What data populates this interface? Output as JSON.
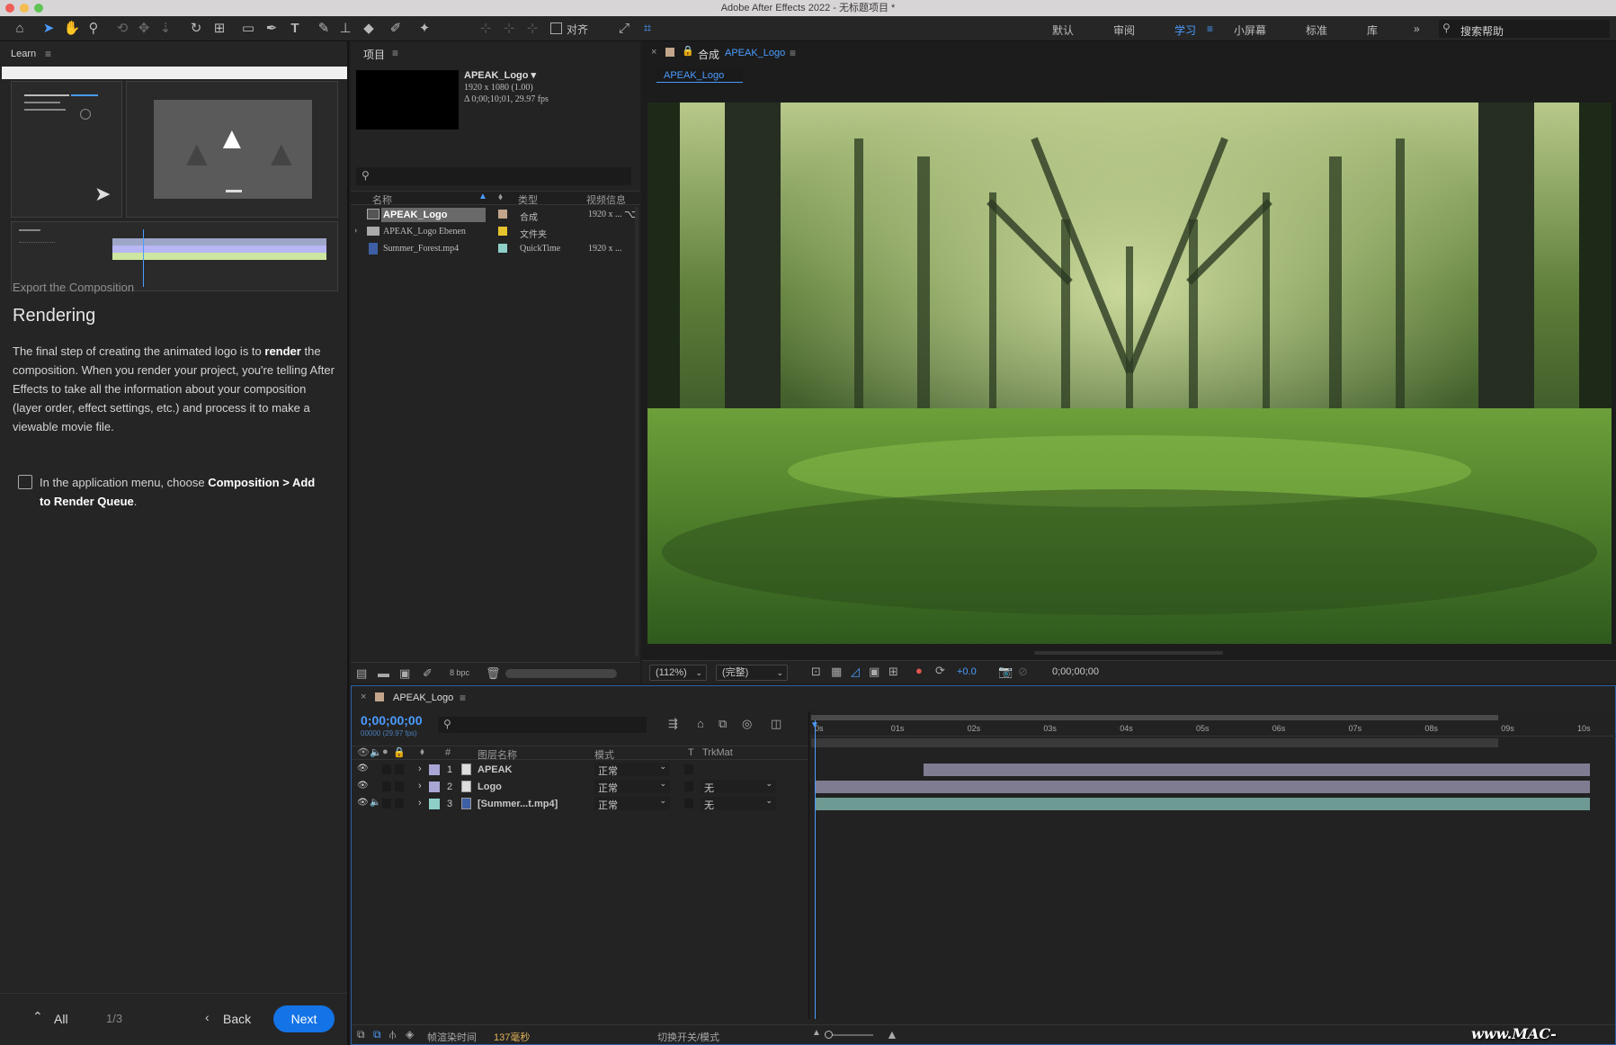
{
  "window": {
    "title": "Adobe After Effects 2022 - 无标题项目 *"
  },
  "toolbar": {
    "snap_label": "对齐"
  },
  "workspaces": [
    {
      "label": "默认",
      "active": false
    },
    {
      "label": "审阅",
      "active": false
    },
    {
      "label": "学习",
      "active": true
    },
    {
      "label": "小屏幕",
      "active": false
    },
    {
      "label": "标准",
      "active": false
    },
    {
      "label": "库",
      "active": false
    }
  ],
  "search_help": {
    "placeholder": "搜索帮助"
  },
  "learn": {
    "tab": "Learn",
    "section_label": "Export the Composition",
    "title": "Rendering",
    "body_1": "The final step of creating the animated logo is to ",
    "body_bold": "render",
    "body_2": " the composition. When you render your project, you're telling After Effects to take all the information about your composition (layer order, effect settings, etc.) and process it to make a viewable movie file.",
    "task_1": "In the application menu, choose ",
    "task_bold": "Composition > Add to Render Queue",
    "task_end": ".",
    "footer": {
      "all_label": "All",
      "page": "1/3",
      "back_label": "Back",
      "next_label": "Next"
    }
  },
  "project": {
    "tab": "项目",
    "selected_name": "APEAK_Logo ▾",
    "selected_dims": "1920 x 1080 (1.00)",
    "selected_dur": "Δ 0;00;10;01, 29.97 fps",
    "columns": {
      "name": "名称",
      "type": "类型",
      "video": "视频信息"
    },
    "items": [
      {
        "name": "APEAK_Logo",
        "type": "合成",
        "video": "1920 x ...",
        "color": "#c2a58a",
        "selected": true
      },
      {
        "name": "APEAK_Logo Ebenen",
        "type": "文件夹",
        "video": "",
        "color": "#e6c42c",
        "selected": false
      },
      {
        "name": "Summer_Forest.mp4",
        "type": "QuickTime",
        "video": "1920 x ...",
        "color": "#8ecfc8",
        "selected": false
      }
    ],
    "bpc": "8 bpc"
  },
  "composition": {
    "tab_prefix": "合成",
    "tab_name": "APEAK_Logo",
    "subtab": "APEAK_Logo",
    "zoom": "(112%)",
    "resolution": "(完整)",
    "exposure": "+0.0",
    "timecode": "0;00;00;00"
  },
  "timeline": {
    "tab": "APEAK_Logo",
    "current_time": "0;00;00;00",
    "fps": "00000 (29.97 fps)",
    "columns": {
      "num": "#",
      "layer_name": "图层名称",
      "mode": "模式",
      "t": "T",
      "trkmat": "TrkMat"
    },
    "ruler": [
      "0s",
      "01s",
      "02s",
      "03s",
      "04s",
      "05s",
      "06s",
      "07s",
      "08s",
      "09s",
      "10s"
    ],
    "layers": [
      {
        "num": "1",
        "name": "APEAK",
        "mode": "正常",
        "trkmat": "",
        "color": "#a9a6d6",
        "bar_color": "#7f7c92",
        "bar_start": 0.14,
        "has_audio": false
      },
      {
        "num": "2",
        "name": "Logo",
        "mode": "正常",
        "trkmat": "无",
        "color": "#a9a6d6",
        "bar_color": "#7f7c92",
        "bar_start": 0.0,
        "has_audio": false
      },
      {
        "num": "3",
        "name": "[Summer...t.mp4]",
        "mode": "正常",
        "trkmat": "无",
        "color": "#8ecfc8",
        "bar_color": "#6e9a94",
        "bar_start": 0.0,
        "has_audio": true
      }
    ],
    "footer": {
      "render_time_label": "帧渲染时间",
      "render_time_value": "137毫秒",
      "toggle_label": "切换开关/模式"
    }
  },
  "watermark": "www.MAC-GM.COM"
}
